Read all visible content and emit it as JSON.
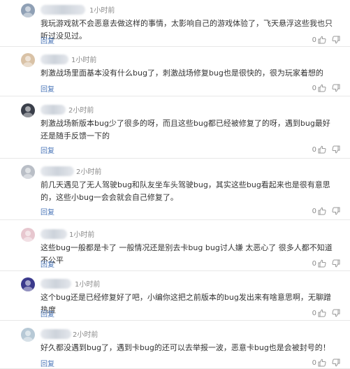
{
  "comments": [
    {
      "time": "1小时前",
      "text": "我玩游戏就不会恶意去做这样的事情，太影响自己的游戏体验了，飞天悬浮这些我也只听过没见过。",
      "reply": "回复",
      "likes": "0",
      "avatar_color": "#8fa0b5"
    },
    {
      "time": "1小时前",
      "text": "刺激战场里面基本没有什么bug了，刺激战场修复bug也是很快的，很为玩家着想的",
      "reply": "回复",
      "likes": "0",
      "avatar_color": "#d9c2a6"
    },
    {
      "time": "2小时前",
      "text": "刺激战场新版本bug少了很多的呀，而且这些bug都已经被修复了的呀，遇到bug最好还是随手反馈一下的",
      "reply": "回复",
      "likes": "0",
      "avatar_color": "#3a3f4a"
    },
    {
      "time": "2小时前",
      "text": "前几天遇见了无人驾驶bug和队友坐车头驾驶bug，其实这些bug看起来也是很有意思的，这些小bug一会会就会自己修复了。",
      "reply": "回复",
      "likes": "0",
      "avatar_color": "#b9bec6"
    },
    {
      "time": "1小时前",
      "text": "这些bug一般都是卡了 一般情况还是别去卡bug bug讨人嫌 太恶心了 很多人都不知道不公平",
      "reply": "回复",
      "likes": "0",
      "avatar_color": "#e7c7cf"
    },
    {
      "time": "1小时前",
      "text": "这个bug还是已经修复好了吧，小编你这把之前版本的bug发出来有啥意思啊，无聊蹭热度",
      "reply": "回复",
      "likes": "0",
      "avatar_color": "#3b3a8c"
    },
    {
      "time": "2小时前",
      "text": "好久都没遇到bug了，遇到卡bug的还可以去举报一波，恶意卡bug也是会被封号的！",
      "reply": "回复",
      "likes": "0",
      "avatar_color": "#b7c9d6"
    }
  ],
  "icons": {
    "like": "thumbs-up-icon",
    "dislike": "thumbs-down-icon"
  }
}
